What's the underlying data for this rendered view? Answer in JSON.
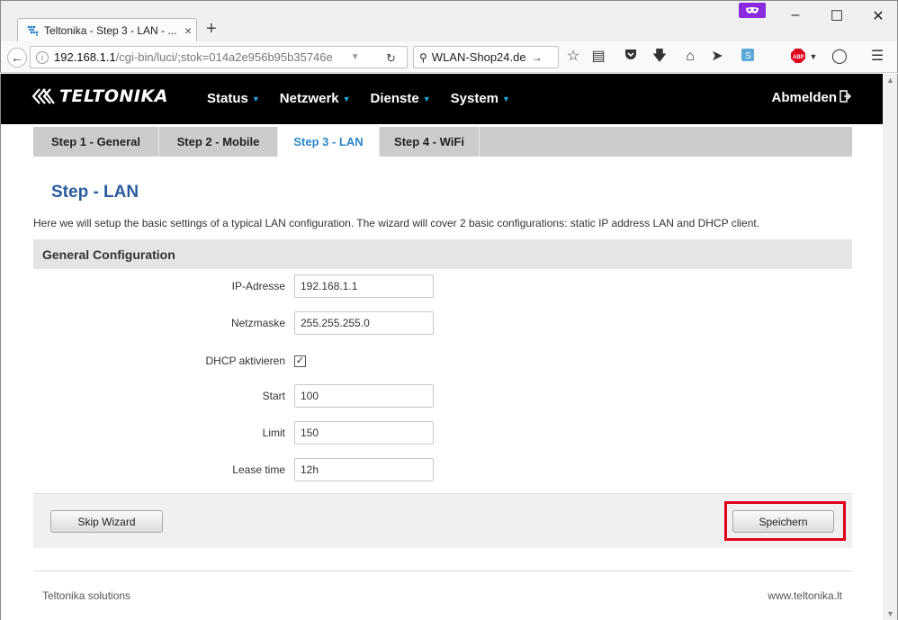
{
  "browser": {
    "tab_title": "Teltonika - Step 3 - LAN - ...",
    "tab_close": "×",
    "new_tab": "+",
    "url_host": "192.168.1.1",
    "url_path": "/cgi-bin/luci/;stok=014a2e956b95b35746e",
    "search_text": "WLAN-Shop24.de",
    "window_controls": {
      "minimize": "–",
      "maximize": "☐",
      "close": "✕"
    }
  },
  "header": {
    "brand": "TELTONIKA",
    "menu": [
      {
        "label": "Status"
      },
      {
        "label": "Netzwerk"
      },
      {
        "label": "Dienste"
      },
      {
        "label": "System"
      }
    ],
    "logout_label": "Abmelden"
  },
  "steps": [
    {
      "label": "Step 1 - General",
      "active": false
    },
    {
      "label": "Step 2 - Mobile",
      "active": false
    },
    {
      "label": "Step 3 - LAN",
      "active": true
    },
    {
      "label": "Step 4 - WiFi",
      "active": false
    }
  ],
  "page": {
    "title": "Step - LAN",
    "description": "Here we will setup the basic settings of a typical LAN configuration. The wizard will cover 2 basic configurations: static IP address LAN and DHCP client.",
    "section_title": "General Configuration"
  },
  "form": {
    "ip": {
      "label": "IP-Adresse",
      "value": "192.168.1.1"
    },
    "netmask": {
      "label": "Netzmaske",
      "value": "255.255.255.0"
    },
    "dhcp": {
      "label": "DHCP aktivieren",
      "checked": true,
      "mark": "✓"
    },
    "start": {
      "label": "Start",
      "value": "100"
    },
    "limit": {
      "label": "Limit",
      "value": "150"
    },
    "lease": {
      "label": "Lease time",
      "value": "12h"
    }
  },
  "buttons": {
    "skip": "Skip Wizard",
    "save": "Speichern"
  },
  "footer": {
    "left": "Teltonika solutions",
    "right": "www.teltonika.lt"
  },
  "colors": {
    "accent": "#2a87c8",
    "title_blue": "#2a5c9e",
    "highlight_red": "#e0001b",
    "nav_bg": "#000000"
  }
}
